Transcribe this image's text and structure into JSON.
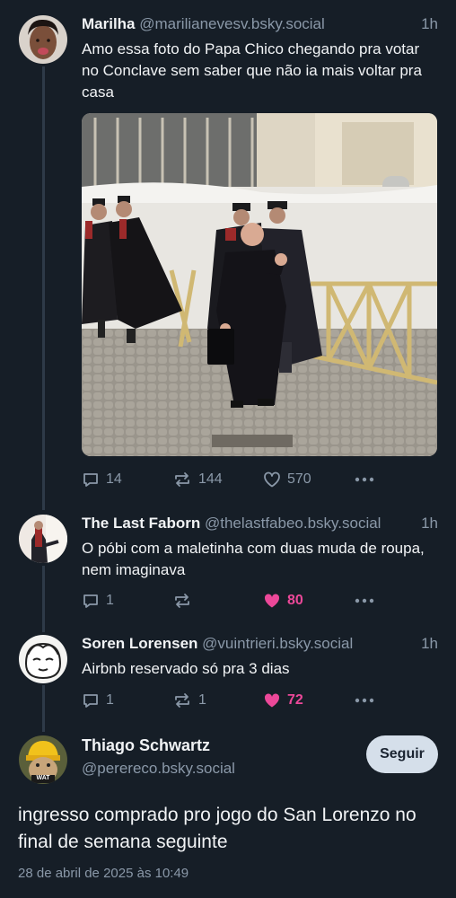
{
  "posts": [
    {
      "name": "Marilha",
      "handle": "@marilianevesv.bsky.social",
      "time": "1h",
      "text": "Amo essa foto do Papa Chico chegando pra votar no Conclave sem saber que não ia mais voltar pra casa",
      "replies": "14",
      "reposts": "144",
      "likes": "570"
    },
    {
      "name": "The Last Faborn",
      "handle": "@thelastfabeo.bsky.social",
      "time": "1h",
      "text": "O póbi com a maletinha com duas muda de roupa, nem imaginava",
      "replies": "1",
      "reposts": "",
      "likes": "80"
    },
    {
      "name": "Soren Lorensen",
      "handle": "@vuintrieri.bsky.social",
      "time": "1h",
      "text": "Airbnb reservado só pra 3 dias",
      "replies": "1",
      "reposts": "1",
      "likes": "72"
    }
  ],
  "main_post": {
    "name": "Thiago Schwartz",
    "handle": "@perereco.bsky.social",
    "follow_label": "Seguir",
    "text": "ingresso comprado pro jogo do San Lorenzo no final de semana seguinte",
    "date": "28 de abril de 2025 às 10:49",
    "avatar_badge": "WAT"
  },
  "colors": {
    "background": "#161e27",
    "muted": "#8a98a8",
    "like_active": "#ec4899",
    "button_bg": "#d5dfea"
  }
}
